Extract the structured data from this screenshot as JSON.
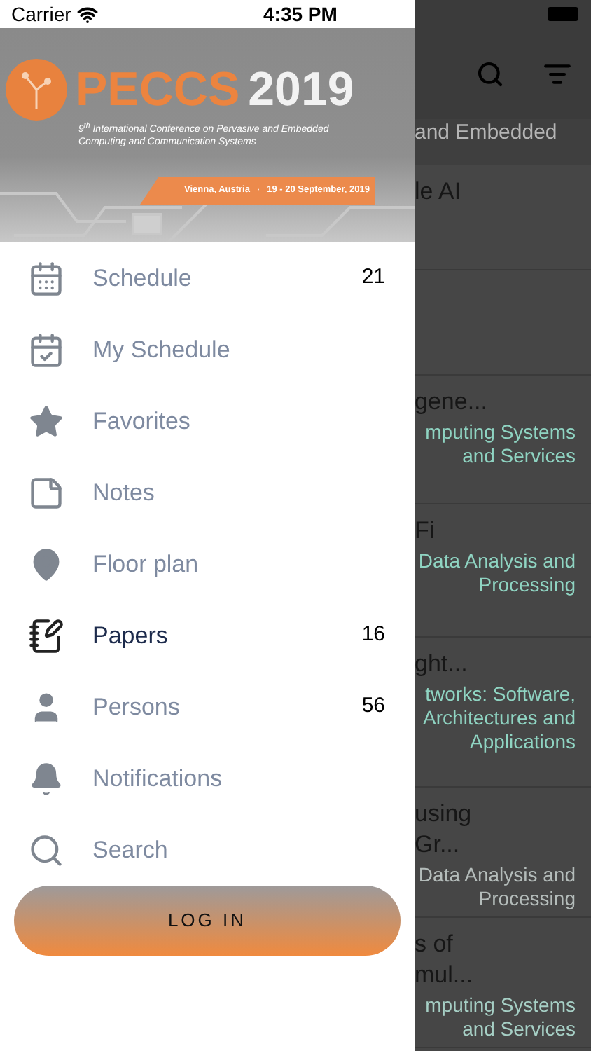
{
  "status_bar": {
    "carrier": "Carrier",
    "time": "4:35 PM"
  },
  "banner": {
    "title": "PECCS",
    "year": "2019",
    "subtitle": "9$^{th}$ International Conference on Pervasive and Embedded Computing and Communication Systems",
    "location": "Vienna, Austria",
    "separator": "·",
    "dates": "19 - 20 September, 2019"
  },
  "menu": [
    {
      "label": "Schedule",
      "count": "21",
      "selected": false
    },
    {
      "label": "My Schedule",
      "selected": false
    },
    {
      "label": "Favorites",
      "selected": false
    },
    {
      "label": "Notes",
      "selected": false
    },
    {
      "label": "Floor plan",
      "selected": false
    },
    {
      "label": "Papers",
      "count": "16",
      "selected": true
    },
    {
      "label": "Persons",
      "count": "56",
      "selected": false
    },
    {
      "label": "Notifications",
      "selected": false
    },
    {
      "label": "Search",
      "selected": false
    }
  ],
  "login_button": "LOG IN",
  "background_list": {
    "top_text": "and Embedded",
    "rows": [
      {
        "title": [
          "le AI"
        ]
      },
      {
        "title": []
      },
      {
        "title": [
          "gene..."
        ],
        "track": [
          "mputing Systems",
          "and Services"
        ],
        "color": "#8fd4c2"
      },
      {
        "title": [
          "Fi"
        ],
        "track": [
          "Data Analysis and",
          "Processing"
        ],
        "color": "#8fd4c2"
      },
      {
        "title": [
          "ght..."
        ],
        "track": [
          "tworks: Software,",
          "Architectures and",
          "Applications"
        ],
        "color": "#8fd4c2"
      },
      {
        "title": [
          "using",
          "Gr..."
        ],
        "track": [
          "Data Analysis and",
          "Processing"
        ],
        "color": "#b4bcba"
      },
      {
        "title": [
          "s of",
          "mul..."
        ],
        "track": [
          "mputing Systems",
          "and Services"
        ],
        "color": "#a6cfc5"
      }
    ]
  }
}
